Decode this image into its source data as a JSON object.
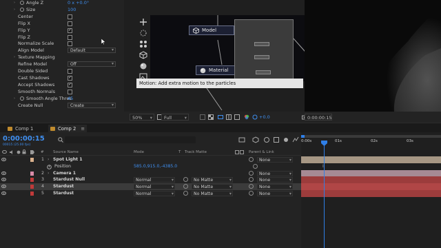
{
  "effect_controls": {
    "rows": [
      {
        "label": "Angle Z",
        "value": "0 x +0.0°",
        "kind": "value",
        "stopwatch": true,
        "twirl": true
      },
      {
        "label": "Size",
        "value": "100",
        "kind": "value",
        "stopwatch": true,
        "twirl": true
      },
      {
        "label": "Center",
        "kind": "check",
        "checked": false
      },
      {
        "label": "Flip X",
        "kind": "check",
        "checked": false
      },
      {
        "label": "Flip Y",
        "kind": "check",
        "checked": true
      },
      {
        "label": "Flip Z",
        "kind": "check",
        "checked": false
      },
      {
        "label": "Normalize Scale",
        "kind": "check",
        "checked": false
      },
      {
        "label": "Align Model",
        "value": "Default",
        "kind": "dropdown"
      },
      {
        "label": "Texture Mapping",
        "kind": "group",
        "twirl": true
      },
      {
        "label": "Refine Model",
        "value": "Off",
        "kind": "dropdown"
      },
      {
        "label": "Double Sided",
        "kind": "check",
        "checked": false
      },
      {
        "label": "Cast Shadows",
        "kind": "check",
        "checked": true
      },
      {
        "label": "Accept Shadows",
        "kind": "check",
        "checked": true
      },
      {
        "label": "Smooth Normals",
        "kind": "check",
        "checked": false
      },
      {
        "label": "Smooth Angle Thres",
        "value": "45",
        "kind": "value",
        "stopwatch": true,
        "twirl": true
      },
      {
        "label": "Create Null",
        "value": "Create",
        "kind": "dropdown"
      }
    ]
  },
  "node_graph": {
    "nodes": {
      "model": "Model",
      "material": "Material"
    },
    "tooltip": "Motion: Add extra motion to the particles"
  },
  "viewer_bar": {
    "zoom": "50%",
    "resolution": "Full",
    "exposure": "+0.0",
    "timecode": "0:00:00:15"
  },
  "timeline": {
    "tabs": [
      {
        "label": "Comp 1",
        "color": "#c08b2e",
        "active": false
      },
      {
        "label": "Comp 2",
        "color": "#c08b2e",
        "active": true
      }
    ],
    "timecode": "0:00:00:15",
    "fps": "00015 (25.00 fps)",
    "columns": {
      "num": "#",
      "source_name": "Source Name",
      "mode": "Mode",
      "t": "T",
      "track_matte": "Track Matte",
      "parent_link": "Parent & Link"
    },
    "ruler": {
      "start": "0:00s",
      "ticks": [
        "01s",
        "02s",
        "03s"
      ]
    },
    "layers": [
      {
        "num": "1",
        "name": "Spot Light 1",
        "label_color": "#d9b08c",
        "parent": "None",
        "mode": "",
        "matte": ""
      },
      {
        "num": "",
        "name": "Position",
        "value": "585.0,915.0,-4385.0",
        "is_property": true
      },
      {
        "num": "2",
        "name": "Camera 1",
        "label_color": "#d98ca8",
        "parent": "None",
        "mode": "",
        "matte": ""
      },
      {
        "num": "3",
        "name": "Stardust Null",
        "label_color": "#c03a3a",
        "parent": "None",
        "mode": "Normal",
        "matte": "No Matte"
      },
      {
        "num": "4",
        "name": "Stardust",
        "label_color": "#c03a3a",
        "parent": "None",
        "mode": "Normal",
        "matte": "No Matte",
        "selected": true
      },
      {
        "num": "5",
        "name": "Stardust",
        "label_color": "#c03a3a",
        "parent": "None",
        "mode": "Normal",
        "matte": "No Matte"
      }
    ],
    "bars": [
      {
        "color": "#a69784"
      },
      {
        "color": "#1f1f1f"
      },
      {
        "color": "#a68a94"
      },
      {
        "color": "#9c3c3c"
      },
      {
        "color": "#b04646"
      },
      {
        "color": "#9c3c3c"
      }
    ],
    "colors": {
      "accent": "#2f7fe8",
      "timecode": "#3f8ff0"
    }
  }
}
